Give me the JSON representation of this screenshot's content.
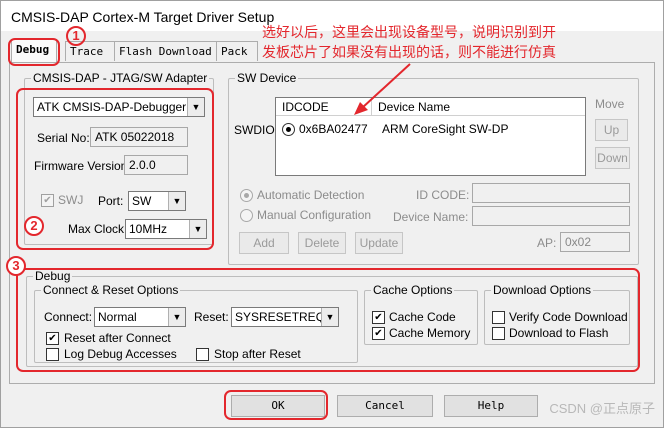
{
  "window": {
    "title": "CMSIS-DAP Cortex-M Target Driver Setup"
  },
  "tabs": [
    {
      "label": "Debug",
      "active": true
    },
    {
      "label": "Trace",
      "active": false
    },
    {
      "label": "Flash Download",
      "active": false
    },
    {
      "label": "Pack",
      "active": false
    }
  ],
  "adapter": {
    "title": "CMSIS-DAP - JTAG/SW Adapter",
    "selected": "ATK CMSIS-DAP-Debugger",
    "serial_label": "Serial No:",
    "serial_value": "ATK 05022018",
    "firmware_label": "Firmware Version:",
    "firmware_value": "2.0.0",
    "swj_label": "SWJ",
    "swj_checked": true,
    "port_label": "Port:",
    "port_value": "SW",
    "maxclock_label": "Max Clock:",
    "maxclock_value": "10MHz"
  },
  "sw_device": {
    "title": "SW Device",
    "swdio_label": "SWDIO",
    "col_idcode": "IDCODE",
    "col_device": "Device Name",
    "row_idcode": "0x6BA02477",
    "row_device": "ARM CoreSight SW-DP",
    "move_label": "Move",
    "up_label": "Up",
    "down_label": "Down",
    "auto_detection": "Automatic Detection",
    "manual_config": "Manual Configuration",
    "id_code_label": "ID CODE:",
    "device_name_label": "Device Name:",
    "add_label": "Add",
    "delete_label": "Delete",
    "update_label": "Update",
    "ap_label": "AP:",
    "ap_value": "0x02"
  },
  "debug": {
    "title": "Debug",
    "connect_reset": {
      "title": "Connect & Reset Options",
      "connect_label": "Connect:",
      "connect_value": "Normal",
      "reset_label": "Reset:",
      "reset_value": "SYSRESETREQ",
      "reset_after_connect": "Reset after Connect",
      "log_debug_accesses": "Log Debug Accesses",
      "stop_after_reset": "Stop after Reset"
    },
    "cache": {
      "title": "Cache Options",
      "cache_code": "Cache Code",
      "cache_memory": "Cache Memory"
    },
    "download": {
      "title": "Download Options",
      "verify": "Verify Code Download",
      "download_flash": "Download to Flash"
    }
  },
  "buttons": {
    "ok": "OK",
    "cancel": "Cancel",
    "help": "Help"
  },
  "annotations": {
    "note_line1": "选好以后，这里会出现设备型号，说明识别到开",
    "note_line2": "发板芯片了如果没有出现的话，则不能进行仿真",
    "marker_1": "1",
    "marker_2": "2",
    "marker_3": "3",
    "color": "#e3272d"
  },
  "watermark": "CSDN @正点原子"
}
